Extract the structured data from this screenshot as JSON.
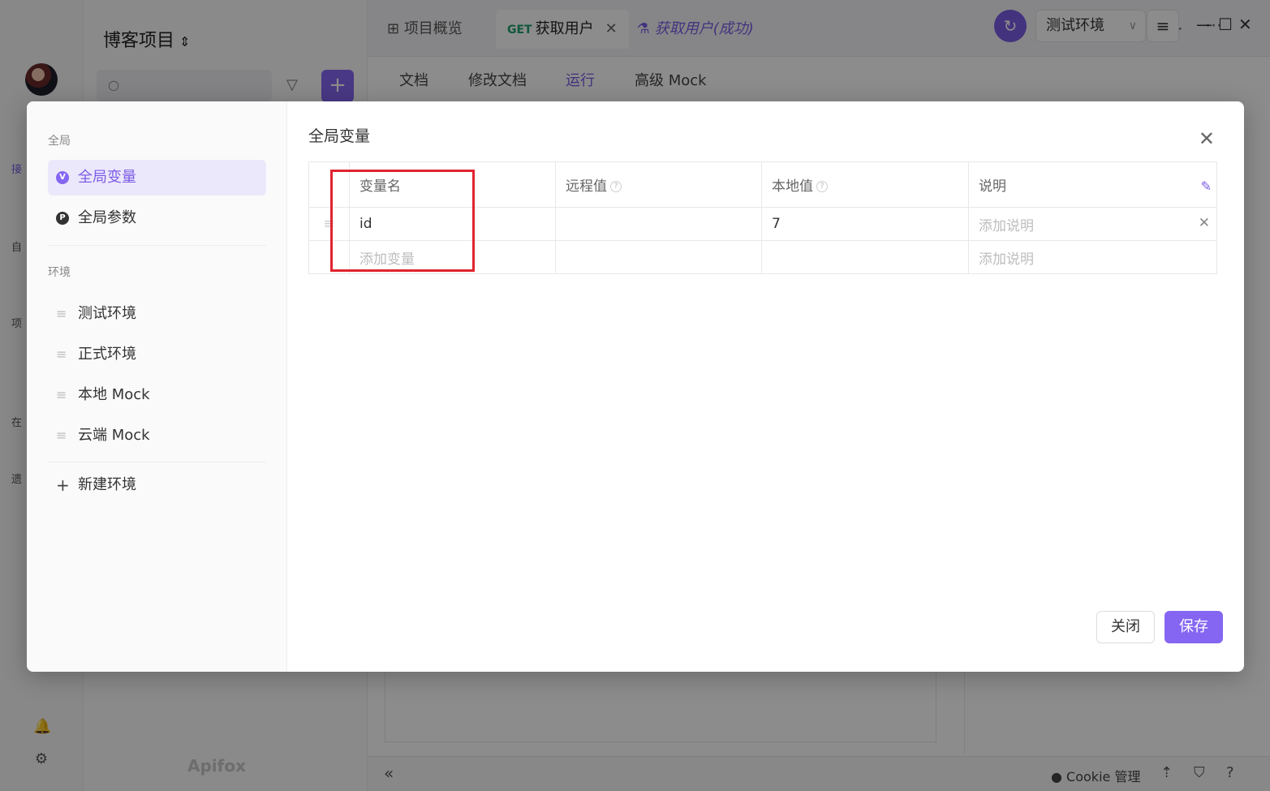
{
  "app": {
    "project_title": "博客项目",
    "brand": "Apifox",
    "rail_labels": [
      "接",
      "自",
      "项",
      "在",
      "遗"
    ],
    "tabs": [
      {
        "label": "项目概览"
      },
      {
        "method": "GET",
        "label": "获取用户"
      },
      {
        "label": "获取用户(成功)"
      }
    ],
    "subtabs": [
      "文档",
      "修改文档",
      "运行",
      "高级 Mock"
    ],
    "active_subtab": "运行",
    "environment": "测试环境",
    "cookie_label": "Cookie 管理"
  },
  "modal": {
    "title": "全局变量",
    "sidebar": {
      "group_global": "全局",
      "global_variables": "全局变量",
      "global_params": "全局参数",
      "group_env": "环境",
      "environments": [
        "测试环境",
        "正式环境",
        "本地 Mock",
        "云端 Mock"
      ],
      "new_env": "新建环境"
    },
    "table": {
      "headers": {
        "name": "变量名",
        "remote": "远程值",
        "local": "本地值",
        "desc": "说明"
      },
      "rows": [
        {
          "name": "id",
          "remote": "",
          "local": "7",
          "desc_placeholder": "添加说明"
        }
      ],
      "new_row": {
        "name_placeholder": "添加变量",
        "desc_placeholder": "添加说明"
      }
    },
    "buttons": {
      "close": "关闭",
      "save": "保存"
    }
  },
  "colors": {
    "accent": "#8566f2",
    "highlight": "#e0242f"
  }
}
